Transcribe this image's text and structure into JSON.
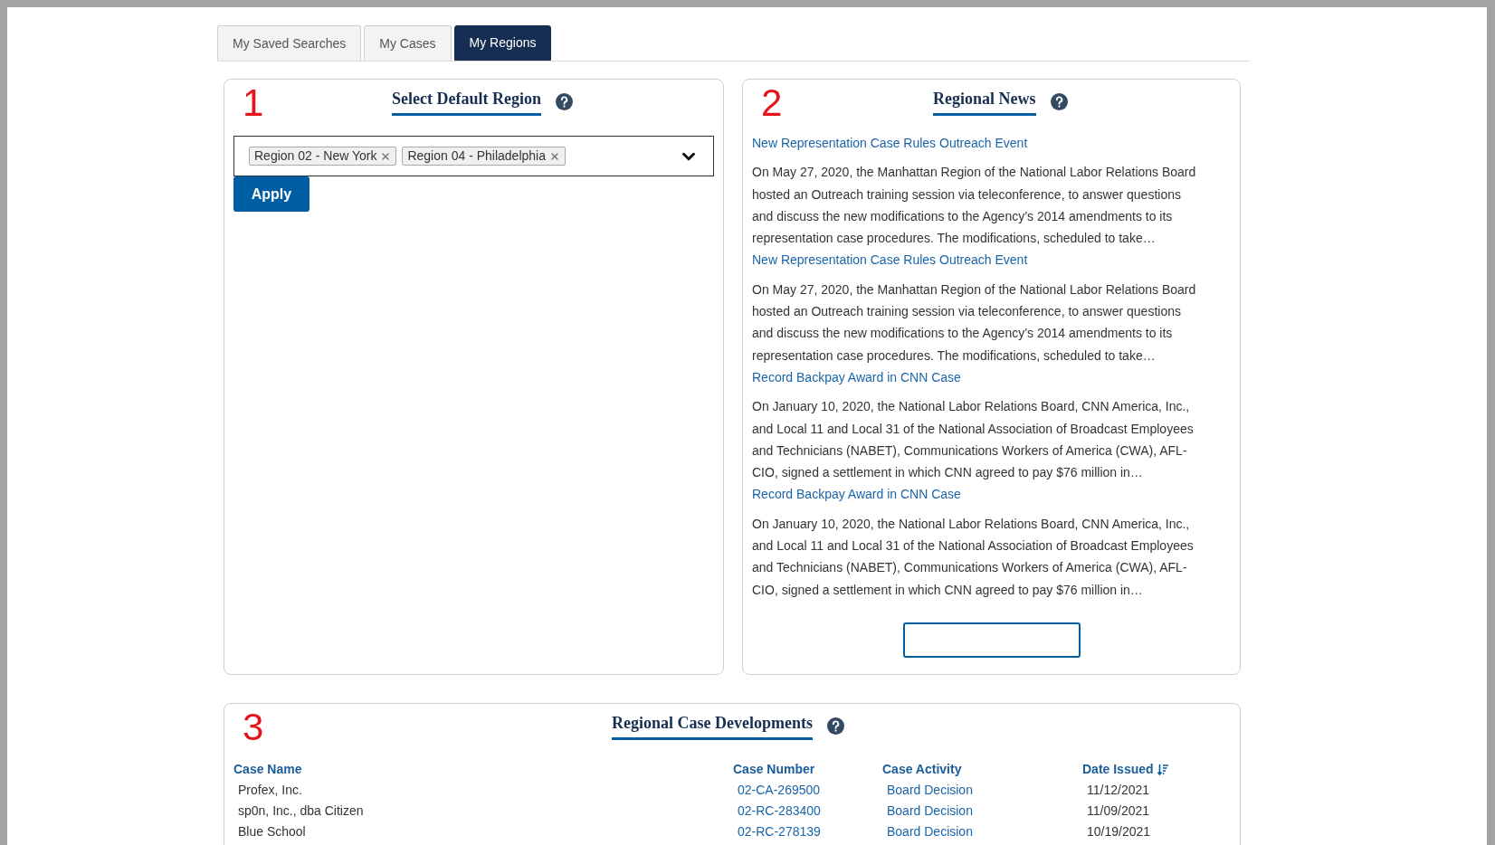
{
  "tabs": [
    {
      "label": "My Saved Searches",
      "selected": false
    },
    {
      "label": "My Cases",
      "selected": false
    },
    {
      "label": "My Regions",
      "selected": true
    }
  ],
  "region_panel": {
    "number": "1",
    "title": "Select Default Region",
    "chips": [
      {
        "label": "Region 02 - New York"
      },
      {
        "label": "Region 04 - Philadelphia"
      }
    ],
    "apply_button": "Apply"
  },
  "news_panel": {
    "number": "2",
    "title": "Regional News",
    "items": [
      {
        "title": "New Representation Case Rules Outreach Event",
        "summary": "On May 27, 2020, the Manhattan Region of the National Labor Relations Board hosted an Outreach training session via teleconference, to answer questions and discuss the new modifications to the Agency’s 2014 amendments to its representation case procedures.  The modifications, scheduled to take…"
      },
      {
        "title": "New Representation Case Rules Outreach Event",
        "summary": "On May 27, 2020, the Manhattan Region of the National Labor Relations Board hosted an Outreach training session via teleconference, to answer questions and discuss the new modifications to the Agency’s 2014 amendments to its representation case procedures.  The modifications, scheduled to take…"
      },
      {
        "title": "Record Backpay Award in CNN Case",
        "summary": "On January 10, 2020, the National Labor Relations Board, CNN America, Inc., and Local 11 and Local 31 of the National Association of Broadcast Employees and Technicians (NABET), Communications Workers of America (CWA), AFL-CIO, signed a settlement in which CNN agreed to pay $76 million in…"
      },
      {
        "title": "Record Backpay Award in CNN Case",
        "summary": "On January 10, 2020, the National Labor Relations Board, CNN America, Inc., and Local 11 and Local 31 of the National Association of Broadcast Employees and Technicians (NABET), Communications Workers of America (CWA), AFL-CIO, signed a settlement in which CNN agreed to pay $76 million in…"
      }
    ]
  },
  "cases_panel": {
    "number": "3",
    "title": "Regional Case Developments",
    "columns": [
      {
        "label": "Case Name",
        "sorted": false
      },
      {
        "label": "Case Number",
        "sorted": false
      },
      {
        "label": "Case Activity",
        "sorted": false
      },
      {
        "label": "Date Issued",
        "sorted": true
      }
    ],
    "rows": [
      {
        "name": "Profex, Inc.",
        "number": "02-CA-269500",
        "activity": "Board Decision",
        "date": "11/12/2021"
      },
      {
        "name": "sp0n, Inc., dba Citizen",
        "number": "02-RC-283400",
        "activity": "Board Decision",
        "date": "11/09/2021"
      },
      {
        "name": "Blue School",
        "number": "02-RC-278139",
        "activity": "Board Decision",
        "date": "10/19/2021"
      }
    ]
  }
}
